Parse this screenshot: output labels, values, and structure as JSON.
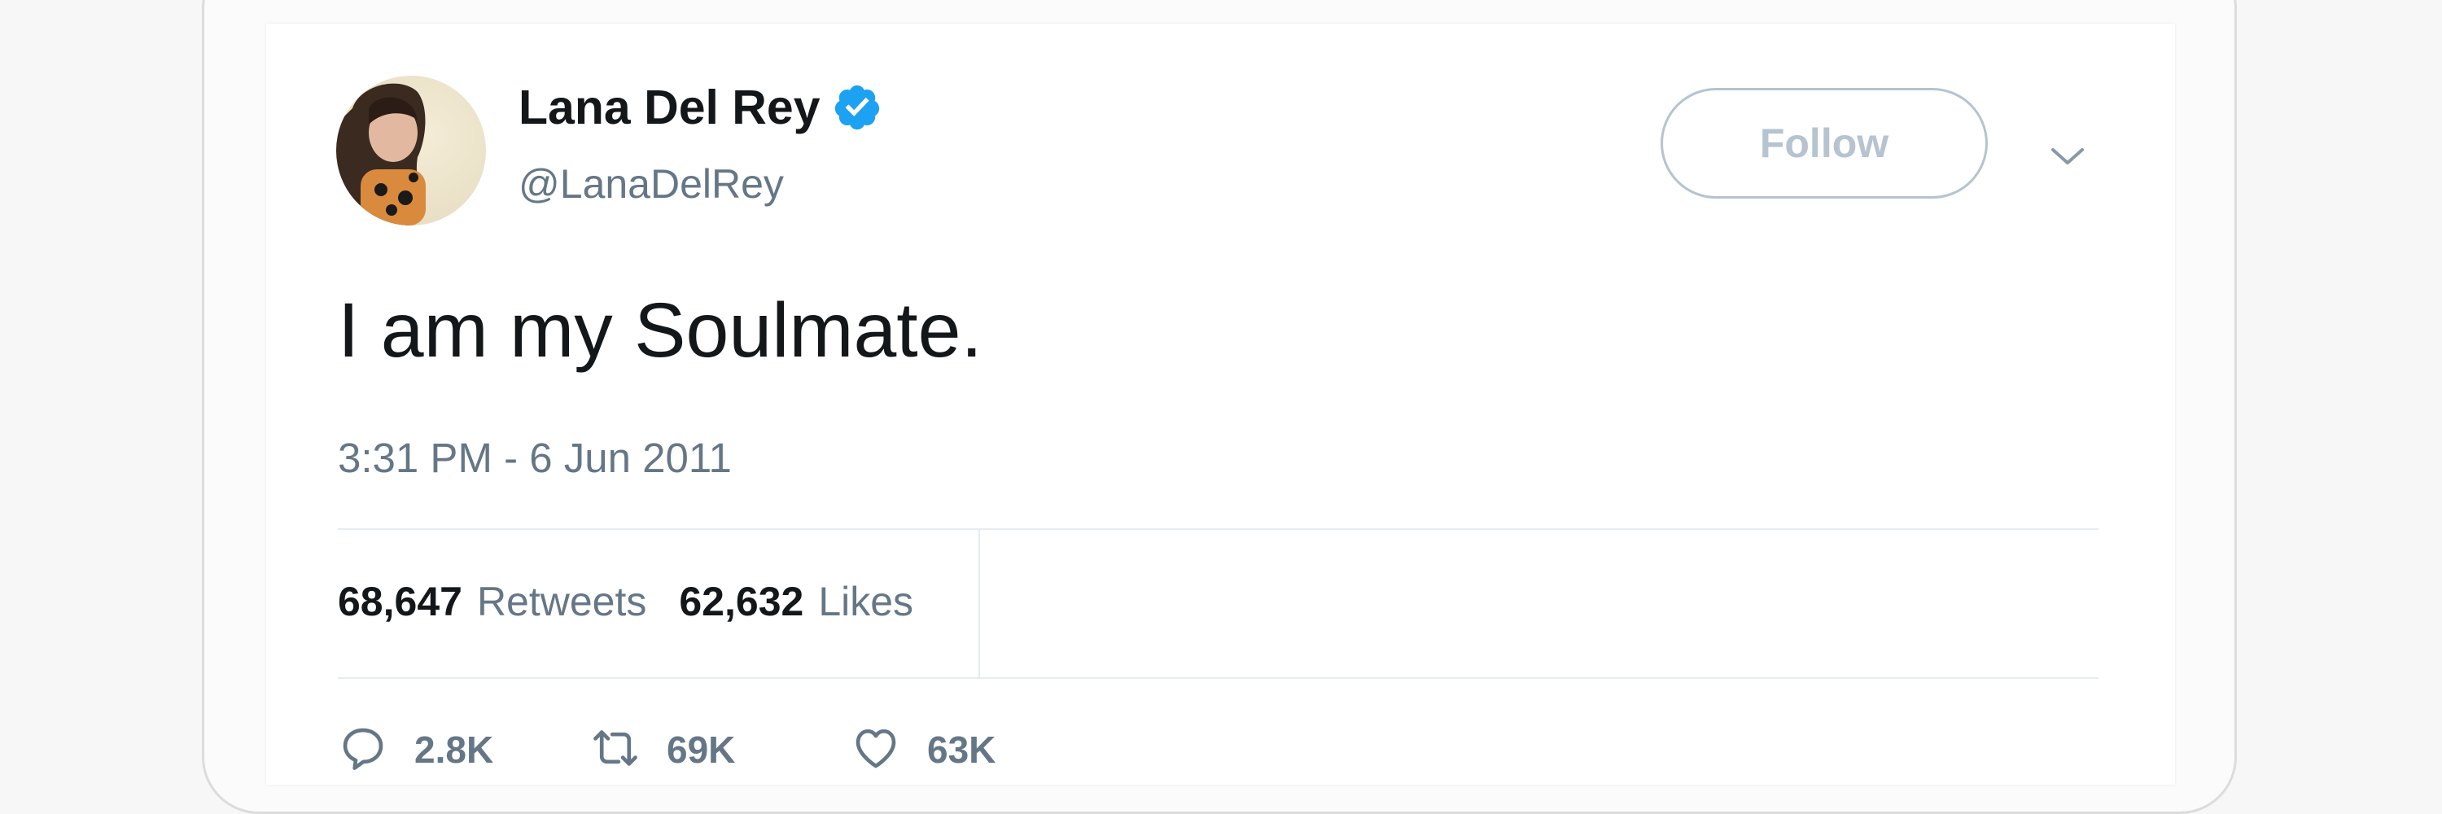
{
  "tweet": {
    "display_name": "Lana Del Rey",
    "handle": "@LanaDelRey",
    "verified": true,
    "text": "I am my Soulmate.",
    "timestamp": "3:31 PM - 6 Jun 2011",
    "follow_label": "Follow",
    "stats": {
      "retweets_count": "68,647",
      "retweets_label": "Retweets",
      "likes_count": "62,632",
      "likes_label": "Likes"
    },
    "actions": {
      "reply_count": "2.8K",
      "retweet_count": "69K",
      "like_count": "63K"
    }
  },
  "colors": {
    "verified": "#1da1f2",
    "follow_border": "#b6c3d0",
    "secondary_text": "#657786",
    "primary_text": "#14171a",
    "divider": "#e6ecf0"
  },
  "icons": [
    "verified-icon",
    "chevron-down-icon",
    "reply-icon",
    "retweet-icon",
    "like-icon"
  ]
}
